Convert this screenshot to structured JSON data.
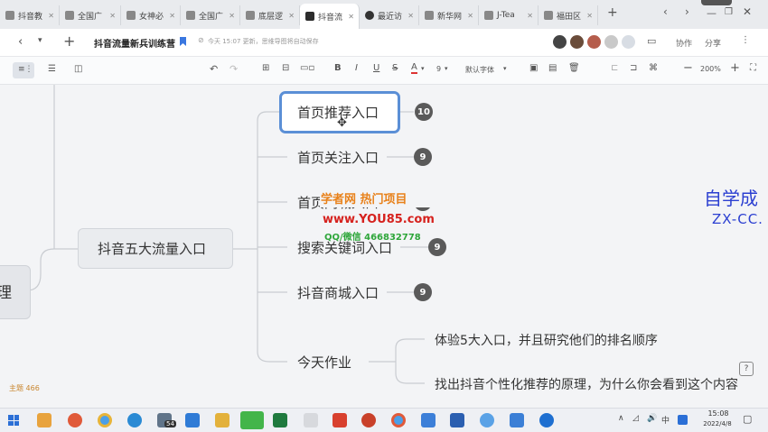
{
  "browser": {
    "tabs": [
      {
        "label": "抖音教",
        "active": false
      },
      {
        "label": "全国广",
        "active": false
      },
      {
        "label": "女神必",
        "active": false
      },
      {
        "label": "全国广",
        "active": false
      },
      {
        "label": "底层逻",
        "active": false
      },
      {
        "label": "抖音流",
        "active": true
      },
      {
        "label": "最近访",
        "active": false
      },
      {
        "label": "新华网",
        "active": false
      },
      {
        "label": "J-Tea",
        "active": false
      },
      {
        "label": "福田区",
        "active": false
      }
    ],
    "new_tab": "+"
  },
  "doc": {
    "title": "抖音流量新兵训练营",
    "save_status": "今天 15:07 更新，思维导图将自动保存",
    "collab_label": "协作",
    "share_label": "分享"
  },
  "toolbar": {
    "font_size": "9",
    "font_family": "默认字体",
    "zoom": "200%"
  },
  "mindmap": {
    "root_partial": "理",
    "branch": "抖音五大流量入口",
    "items": [
      {
        "label": "首页推荐入口",
        "count": "10"
      },
      {
        "label": "首页关注入口",
        "count": "9"
      },
      {
        "label": "首页同城入口",
        "count": "9"
      },
      {
        "label": "搜索关键词入口",
        "count": "9"
      },
      {
        "label": "抖音商城入口",
        "count": "9"
      }
    ],
    "homework": {
      "label": "今天作业",
      "children": [
        "体验5大入口，并且研究他们的排名顺序",
        "找出抖音个性化推荐的原理，为什么你会看到这个内容"
      ]
    },
    "topic_count_label": "主题",
    "topic_count": "466"
  },
  "watermarks": {
    "line1": "学者网 热门项目",
    "line2": "www.YOU85.com",
    "line3": "QQ/微信 466832778",
    "right_line1": "自学成",
    "right_line2": "ZX-CC."
  },
  "taskbar": {
    "time": "15:08",
    "date": "2022/4/8",
    "mail_badge": "54"
  },
  "colors": {
    "selected_border": "#5b8fd6",
    "badge": "#5a5a5a",
    "watermark_orange": "#e8811a",
    "watermark_red": "#d6221e",
    "watermark_green": "#2ea63a",
    "watermark_blue": "#2b3fd1",
    "watermark_purple": "#8a2dbf"
  }
}
